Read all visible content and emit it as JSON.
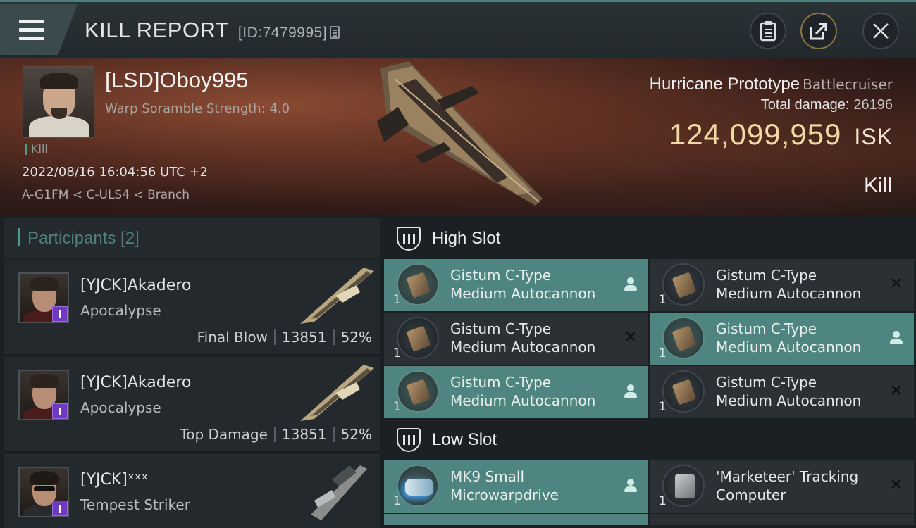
{
  "header": {
    "title": "KILL REPORT",
    "report_id": "[ID:7479995]"
  },
  "victim": {
    "name": "[LSD]Oboy995",
    "warp_scramble": "Warp Soramble Strength: 4.0",
    "tag": "Kill",
    "datetime": "2022/08/16 16:04:56 UTC +2",
    "location": "A-G1FM < C-ULS4 < Branch"
  },
  "ship": {
    "name": "Hurricane Prototype",
    "class": "Battlecruiser",
    "total_damage_label": "Total damage:",
    "total_damage": "26196",
    "value": "124,099,959",
    "currency": "ISK",
    "result": "Kill"
  },
  "participants": {
    "header": "Participants [2]",
    "rows": [
      {
        "name": "[YJCK]Akadero",
        "ship": "Apocalypse",
        "label": "Final Blow",
        "damage": "13851",
        "percent": "52%"
      },
      {
        "name": "[YJCK]Akadero",
        "ship": "Apocalypse",
        "label": "Top Damage",
        "damage": "13851",
        "percent": "52%"
      },
      {
        "name": "[YJCK]ˣˣˣ",
        "ship": "Tempest Striker"
      }
    ]
  },
  "slots": {
    "high": {
      "title": "High Slot",
      "modules": [
        {
          "qty": "1",
          "line1": "Gistum C-Type",
          "line2": "Medium Autocannon",
          "status": "person",
          "active": true,
          "icon": "autocannon"
        },
        {
          "qty": "1",
          "line1": "Gistum C-Type",
          "line2": "Medium Autocannon",
          "status": "x",
          "active": false,
          "icon": "autocannon"
        },
        {
          "qty": "1",
          "line1": "Gistum C-Type",
          "line2": "Medium Autocannon",
          "status": "x",
          "active": false,
          "icon": "autocannon"
        },
        {
          "qty": "1",
          "line1": "Gistum C-Type",
          "line2": "Medium Autocannon",
          "status": "person",
          "active": true,
          "icon": "autocannon"
        },
        {
          "qty": "1",
          "line1": "Gistum C-Type",
          "line2": "Medium Autocannon",
          "status": "person",
          "active": true,
          "icon": "autocannon"
        },
        {
          "qty": "1",
          "line1": "Gistum C-Type",
          "line2": "Medium Autocannon",
          "status": "x",
          "active": false,
          "icon": "autocannon"
        }
      ]
    },
    "low": {
      "title": "Low Slot",
      "modules": [
        {
          "qty": "1",
          "line1": "MK9 Small",
          "line2": "Microwarpdrive",
          "status": "person",
          "active": true,
          "icon": "microwarpdrive"
        },
        {
          "qty": "1",
          "line1": "'Marketeer' Tracking",
          "line2": "Computer",
          "status": "x",
          "active": false,
          "icon": "tracking-computer"
        }
      ]
    }
  },
  "colors": {
    "accent": "#4f8580",
    "isk": "#f1d9a4",
    "badge": "#6f39c4"
  }
}
